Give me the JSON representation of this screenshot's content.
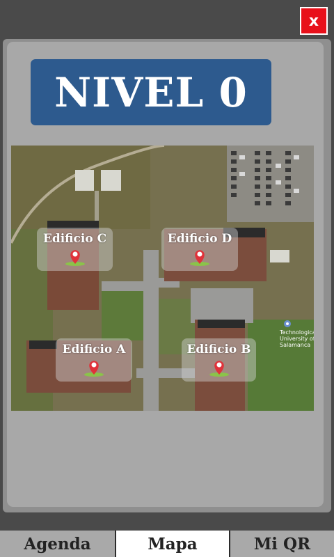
{
  "header": {
    "close_label": "x"
  },
  "banner": {
    "title": "NIVEL 0"
  },
  "map": {
    "buildings": [
      {
        "label": "Edificio C"
      },
      {
        "label": "Edificio D"
      },
      {
        "label": "Edificio A"
      },
      {
        "label": "Edificio B"
      }
    ],
    "poi": {
      "label": "Technological University of Salamanca"
    },
    "pin_color": "#e0323a",
    "pin_base_color": "#8bc34a"
  },
  "tabs": [
    {
      "label": "Agenda",
      "active": false
    },
    {
      "label": "Mapa",
      "active": true
    },
    {
      "label": "Mi QR",
      "active": false
    }
  ],
  "colors": {
    "close_button": "#e8101a",
    "banner": "#2d5a8e",
    "panel": "#a8a8a8",
    "background": "#4a4a4a"
  }
}
